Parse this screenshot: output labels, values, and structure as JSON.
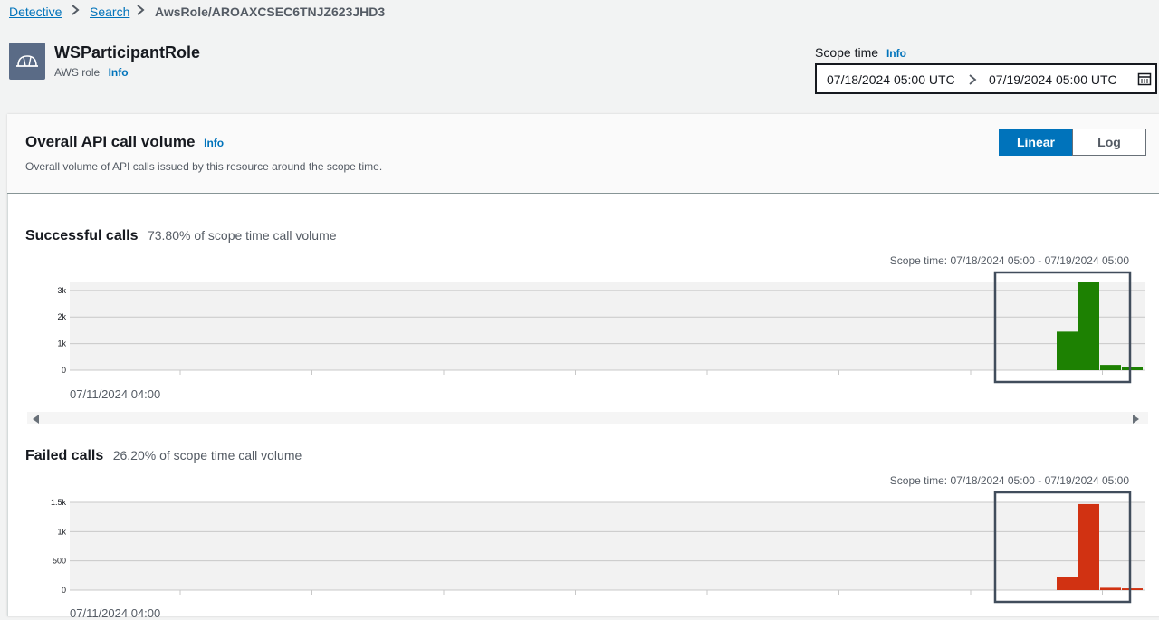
{
  "breadcrumb": {
    "items": [
      "Detective",
      "Search"
    ],
    "current": "AwsRole/AROAXCSEC6TNJZ623JHD3"
  },
  "entity": {
    "name": "WSParticipantRole",
    "type": "AWS role",
    "info": "Info",
    "icon": "hard-hat-icon"
  },
  "scope": {
    "label": "Scope time",
    "info": "Info",
    "start": "07/18/2024 05:00 UTC",
    "end": "07/19/2024 05:00 UTC"
  },
  "panel": {
    "title": "Overall API call volume",
    "info": "Info",
    "description": "Overall volume of API calls issued by this resource around the scope time.",
    "scale_options": [
      "Linear",
      "Log"
    ],
    "selected_scale": "Linear"
  },
  "successful": {
    "title": "Successful calls",
    "subtitle": "73.80% of scope time call volume",
    "scope_note": "Scope time: 07/18/2024 05:00 - 07/19/2024 05:00",
    "x_label": "07/11/2024 04:00"
  },
  "failed": {
    "title": "Failed calls",
    "subtitle": "26.20% of scope time call volume",
    "scope_note": "Scope time: 07/18/2024 05:00 - 07/19/2024 05:00",
    "x_label": "07/11/2024 04:00"
  },
  "chart_data": [
    {
      "type": "bar",
      "color": "#1d8102",
      "ylim": [
        0,
        3300
      ],
      "yticks": [
        0,
        1000,
        2000,
        3000
      ],
      "ytick_labels": [
        "0",
        "1k",
        "2k",
        "3k"
      ],
      "xlabel": "07/11/2024 04:00",
      "values": [
        1450,
        3300,
        200,
        130
      ]
    },
    {
      "type": "bar",
      "color": "#d13212",
      "ylim": [
        0,
        1500
      ],
      "yticks": [
        0,
        500,
        1000,
        1500
      ],
      "ytick_labels": [
        "0",
        "500",
        "1k",
        "1.5k"
      ],
      "xlabel": "07/11/2024 04:00",
      "values": [
        230,
        1470,
        40,
        30
      ]
    }
  ]
}
